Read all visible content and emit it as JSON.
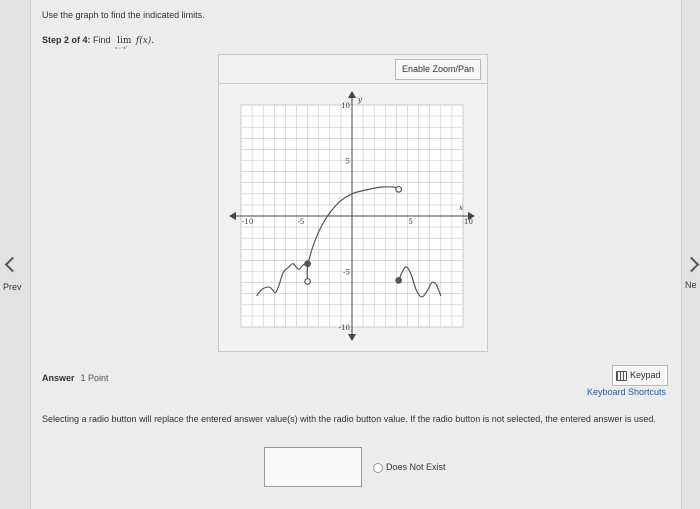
{
  "nav": {
    "prev_label": "Prev",
    "next_label": "Ne"
  },
  "problem": {
    "instruction": "Use the graph to find the indicated limits.",
    "step_label": "Step 2 of 4:",
    "find_text": "Find",
    "lim_word": "lim",
    "lim_sub": "x→−4⁺",
    "function_text": "f(x)."
  },
  "graph_panel": {
    "zoom_button": "Enable Zoom/Pan"
  },
  "graph": {
    "x_axis_name": "x",
    "y_axis_name": "y",
    "x_tick_labels": [
      {
        "value": -10,
        "label": "-10"
      },
      {
        "value": -5,
        "label": "-5"
      },
      {
        "value": 5,
        "label": "5"
      },
      {
        "value": 10,
        "label": "10"
      }
    ],
    "y_tick_labels": [
      {
        "value": 10,
        "label": "10"
      },
      {
        "value": 5,
        "label": "5"
      },
      {
        "value": -5,
        "label": "-5"
      },
      {
        "value": -10,
        "label": "-10"
      }
    ],
    "xlim": [
      -10,
      10
    ],
    "ylim": [
      -10,
      10
    ],
    "grid": true,
    "curve_color": "#555555",
    "grid_color": "#c6c6c6",
    "axis_color": "#444444"
  },
  "chart_data": {
    "type": "line",
    "xlabel": "x",
    "ylabel": "y",
    "xlim": [
      -10,
      10
    ],
    "ylim": [
      -10,
      10
    ],
    "grid": true,
    "series": [
      {
        "points": [
          [
            -8.6,
            -7.2
          ],
          [
            -8.1,
            -6.6
          ],
          [
            -7.5,
            -6.4
          ],
          [
            -7.2,
            -6.6
          ],
          [
            -6.9,
            -6.9
          ],
          [
            -6.6,
            -6.3
          ],
          [
            -6.2,
            -5.1
          ],
          [
            -5.7,
            -4.6
          ],
          [
            -5.3,
            -4.3
          ],
          [
            -4.8,
            -4.8
          ],
          [
            -4.4,
            -4.4
          ],
          [
            -4.0,
            -4.3
          ]
        ],
        "end": {
          "x": -4,
          "y": -4.3,
          "filled": true
        }
      },
      {
        "points": [
          [
            -4.0,
            -5.9
          ],
          [
            -4.0,
            -4.6
          ],
          [
            -3.4,
            -2.4
          ],
          [
            -2.4,
            -0.3
          ],
          [
            -1.2,
            1.2
          ],
          [
            0,
            2.0
          ],
          [
            1.5,
            2.4
          ],
          [
            2.6,
            2.6
          ],
          [
            3.8,
            2.6
          ],
          [
            4.2,
            2.4
          ]
        ],
        "start": {
          "x": -4,
          "y": -5.9,
          "filled": false
        },
        "end": {
          "x": 4.2,
          "y": 2.4,
          "filled": false
        }
      },
      {
        "points": [
          [
            4.2,
            -5.8
          ],
          [
            4.8,
            -4.6
          ],
          [
            5.3,
            -5.2
          ],
          [
            5.8,
            -6.7
          ],
          [
            6.3,
            -7.3
          ],
          [
            6.8,
            -6.7
          ],
          [
            7.2,
            -6.0
          ],
          [
            7.6,
            -6.2
          ],
          [
            8.0,
            -7.2
          ]
        ],
        "start": {
          "x": 4.2,
          "y": -5.8,
          "filled": true
        }
      }
    ]
  },
  "answer": {
    "label": "Answer",
    "points": "1 Point",
    "keypad_label": "Keypad",
    "shortcuts_label": "Keyboard Shortcuts",
    "note": "Selecting a radio button will replace the entered answer value(s) with the radio button value. If the radio button is not selected, the entered answer is used.",
    "radio_label": "Does Not Exist",
    "input_value": ""
  }
}
